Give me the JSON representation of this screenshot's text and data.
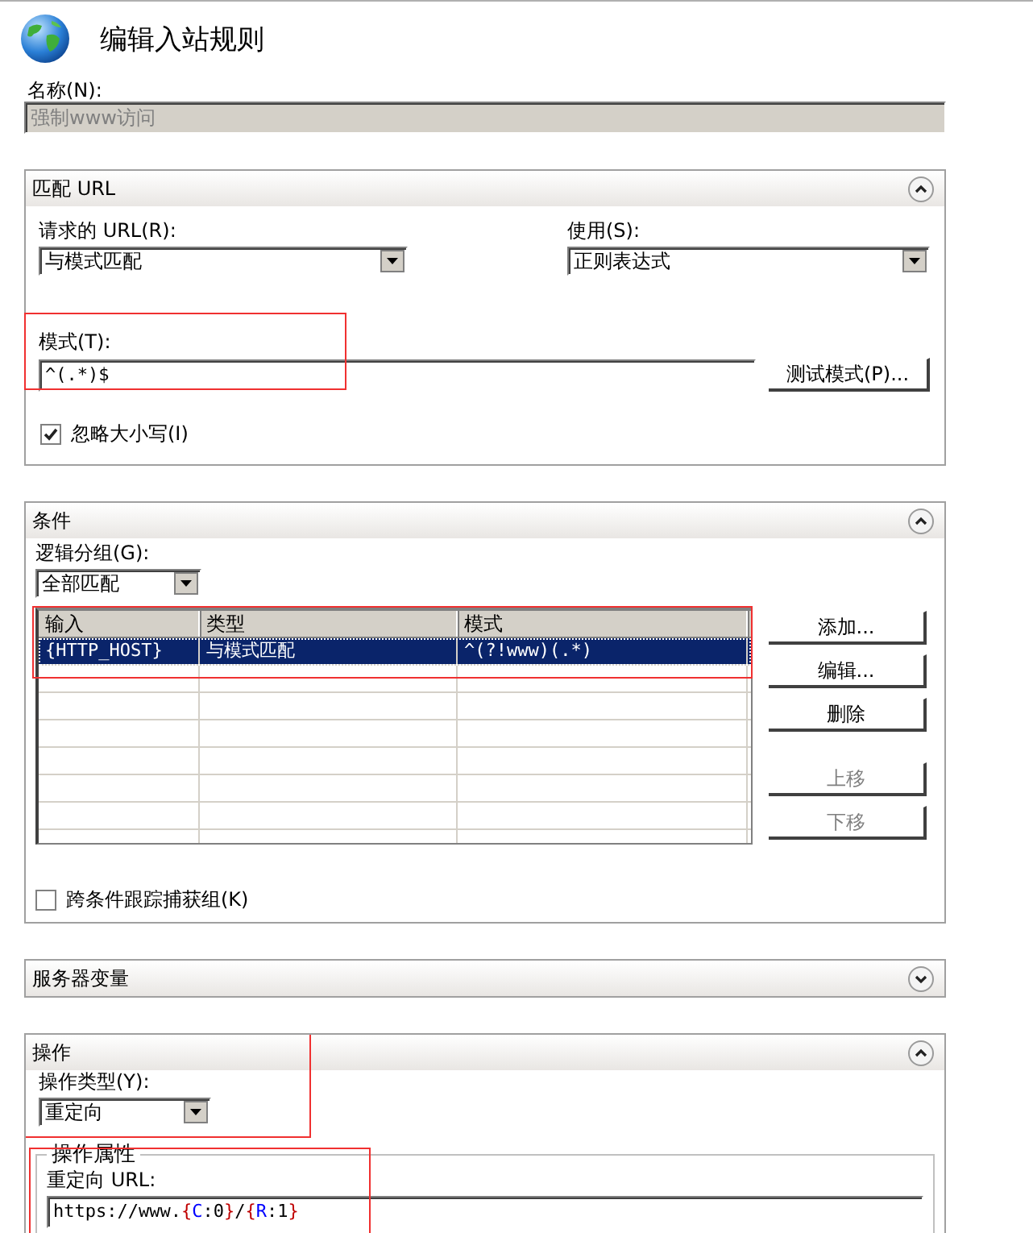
{
  "header": {
    "title": "编辑入站规则"
  },
  "name": {
    "label": "名称(N):",
    "value": "强制www访问",
    "disabled": true
  },
  "match_url": {
    "title": "匹配 URL",
    "expanded": true,
    "requested_url": {
      "label": "请求的 URL(R):",
      "value": "与模式匹配"
    },
    "using": {
      "label": "使用(S):",
      "value": "正则表达式"
    },
    "pattern": {
      "label": "模式(T):",
      "value": "^(.*)$",
      "highlighted": true
    },
    "test_button": "测试模式(P)...",
    "ignore_case": {
      "label": "忽略大小写(I)",
      "checked": true
    }
  },
  "conditions": {
    "title": "条件",
    "expanded": true,
    "logical_grouping": {
      "label": "逻辑分组(G):",
      "value": "全部匹配"
    },
    "table": {
      "highlighted": true,
      "columns": [
        "输入",
        "类型",
        "模式"
      ],
      "rows": [
        {
          "cells": [
            "{HTTP_HOST}",
            "与模式匹配",
            "^(?!www)(.*)"
          ],
          "selected": true
        }
      ]
    },
    "buttons": [
      {
        "label": "添加...",
        "disabled": false
      },
      {
        "label": "编辑...",
        "disabled": false
      },
      {
        "label": "删除",
        "disabled": false
      },
      {
        "label": "上移",
        "disabled": true
      },
      {
        "label": "下移",
        "disabled": true
      }
    ],
    "track_groups": {
      "label": "跨条件跟踪捕获组(K)",
      "checked": false
    }
  },
  "server_variables": {
    "title": "服务器变量",
    "expanded": false
  },
  "action": {
    "title": "操作",
    "expanded": true,
    "action_type": {
      "label": "操作类型(Y):",
      "value": "重定向",
      "highlighted": true
    },
    "properties": {
      "title": "操作属性",
      "highlighted": true,
      "redirect_url": {
        "label": "重定向 URL:",
        "tokens": [
          {
            "text": "https://www.",
            "color": "#000000"
          },
          {
            "text": "{",
            "color": "#c00000"
          },
          {
            "text": "C",
            "color": "#0000ff"
          },
          {
            "text": ":0",
            "color": "#000000"
          },
          {
            "text": "}",
            "color": "#c00000"
          },
          {
            "text": "/",
            "color": "#000000"
          },
          {
            "text": "{",
            "color": "#c00000"
          },
          {
            "text": "R",
            "color": "#0000ff"
          },
          {
            "text": ":1",
            "color": "#000000"
          },
          {
            "text": "}",
            "color": "#c00000"
          }
        ]
      }
    }
  }
}
